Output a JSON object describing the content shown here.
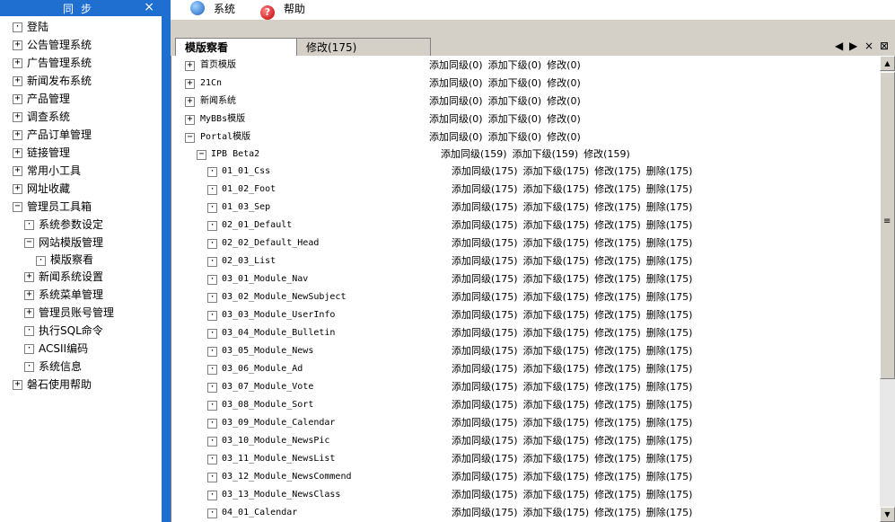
{
  "sidebar": {
    "title": "同步",
    "close": "×",
    "items": [
      {
        "label": "登陆",
        "level": 0,
        "toggle": "·"
      },
      {
        "label": "公告管理系统",
        "level": 0,
        "toggle": "+"
      },
      {
        "label": "广告管理系统",
        "level": 0,
        "toggle": "+"
      },
      {
        "label": "新闻发布系统",
        "level": 0,
        "toggle": "+"
      },
      {
        "label": "产品管理",
        "level": 0,
        "toggle": "+"
      },
      {
        "label": "调查系统",
        "level": 0,
        "toggle": "+"
      },
      {
        "label": "产品订单管理",
        "level": 0,
        "toggle": "+"
      },
      {
        "label": "链接管理",
        "level": 0,
        "toggle": "+"
      },
      {
        "label": "常用小工具",
        "level": 0,
        "toggle": "+"
      },
      {
        "label": "网址收藏",
        "level": 0,
        "toggle": "+"
      },
      {
        "label": "管理员工具箱",
        "level": 0,
        "toggle": "−"
      },
      {
        "label": "系统参数设定",
        "level": 1,
        "toggle": "·"
      },
      {
        "label": "网站模版管理",
        "level": 1,
        "toggle": "−"
      },
      {
        "label": "模版察看",
        "level": 2,
        "toggle": "·"
      },
      {
        "label": "新闻系统设置",
        "level": 1,
        "toggle": "+"
      },
      {
        "label": "系统菜单管理",
        "level": 1,
        "toggle": "+"
      },
      {
        "label": "管理员账号管理",
        "level": 1,
        "toggle": "+"
      },
      {
        "label": "执行SQL命令",
        "level": 1,
        "toggle": "·"
      },
      {
        "label": "ACSII编码",
        "level": 1,
        "toggle": "·"
      },
      {
        "label": "系统信息",
        "level": 1,
        "toggle": "·"
      },
      {
        "label": "磐石使用帮助",
        "level": 0,
        "toggle": "+"
      }
    ]
  },
  "menubar": {
    "system": "系统",
    "help": "帮助",
    "help_icon_glyph": "?"
  },
  "tabs": {
    "view": "模版察看",
    "edit": "修改(175)"
  },
  "tab_controls": {
    "prev": "◀",
    "next": "▶",
    "close": "×",
    "close_all": "⊠"
  },
  "content": {
    "top_items": [
      {
        "name": "首页模版",
        "toggle": "+",
        "actions": [
          "添加同级(0)",
          "添加下级(0)",
          "修改(0)"
        ]
      },
      {
        "name": "21Cn",
        "toggle": "+",
        "actions": [
          "添加同级(0)",
          "添加下级(0)",
          "修改(0)"
        ]
      },
      {
        "name": "新闻系统",
        "toggle": "+",
        "actions": [
          "添加同级(0)",
          "添加下级(0)",
          "修改(0)"
        ]
      },
      {
        "name": "MyBBs模版",
        "toggle": "+",
        "actions": [
          "添加同级(0)",
          "添加下级(0)",
          "修改(0)"
        ]
      },
      {
        "name": "Portal模版",
        "toggle": "−",
        "actions": [
          "添加同级(0)",
          "添加下级(0)",
          "修改(0)"
        ]
      }
    ],
    "group": {
      "name": "IPB Beta2",
      "toggle": "−",
      "actions": [
        "添加同级(159)",
        "添加下级(159)",
        "修改(159)"
      ]
    },
    "leaf_actions": [
      "添加同级(175)",
      "添加下级(175)",
      "修改(175)",
      "删除(175)"
    ],
    "leaves": [
      "01_01_Css",
      "01_02_Foot",
      "01_03_Sep",
      "02_01_Default",
      "02_02_Default_Head",
      "02_03_List",
      "03_01_Module_Nav",
      "03_02_Module_NewSubject",
      "03_03_Module_UserInfo",
      "03_04_Module_Bulletin",
      "03_05_Module_News",
      "03_06_Module_Ad",
      "03_07_Module_Vote",
      "03_08_Module_Sort",
      "03_09_Module_Calendar",
      "03_10_Module_NewsPic",
      "03_11_Module_NewsList",
      "03_12_Module_NewsCommend",
      "03_13_Module_NewsClass",
      "04_01_Calendar"
    ]
  },
  "scrollbar": {
    "up": "▲",
    "down": "▼",
    "grip": "≡"
  },
  "colors": {
    "sidebar_header": "#1e6fd0",
    "tabstrip": "#d4d0c8"
  }
}
